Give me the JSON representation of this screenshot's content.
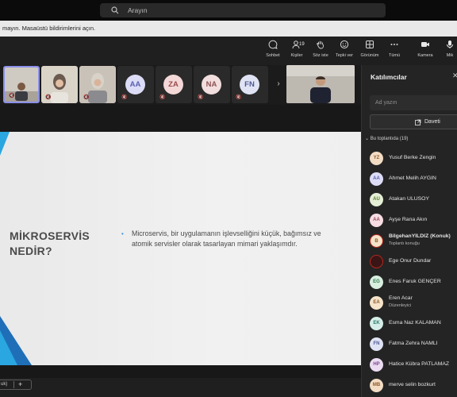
{
  "search": {
    "placeholder": "Arayın"
  },
  "notification": {
    "text": "mayın. Masaüstü bildirimlerini açın."
  },
  "toolbar": {
    "chat": "Sohbet",
    "people": "Kişiler",
    "people_count": "19",
    "raise_hand": "Söz iste",
    "react": "Tepki ver",
    "view": "Görünüm",
    "more": "Tümü",
    "camera": "Kamera",
    "mic": "Mik"
  },
  "tiles": [
    {
      "kind": "video",
      "active": true
    },
    {
      "kind": "video"
    },
    {
      "kind": "video"
    },
    {
      "kind": "avatar",
      "initials": "AA",
      "bg": "#dcdcf7",
      "fg": "#5a5fb0"
    },
    {
      "kind": "avatar",
      "initials": "ZA",
      "bg": "#f4d8d8",
      "fg": "#9a4b4b"
    },
    {
      "kind": "avatar",
      "initials": "NA",
      "bg": "#f2dede",
      "fg": "#8e5353"
    },
    {
      "kind": "avatar",
      "initials": "FN",
      "bg": "#dfe3f4",
      "fg": "#4f5a94"
    }
  ],
  "slide": {
    "title_line1": "MİKROSERVİS",
    "title_line2": "NEDİR?",
    "bullet": "Microservis, bir uygulamanın işlevselliğini küçük, bağımsız ve atomik servisler olarak tasarlayan mimari yaklaşımdır."
  },
  "bottom": {
    "pill_label": "uk)",
    "plus": "+"
  },
  "panel": {
    "title": "Katılımcılar",
    "search_placeholder": "Ad yazın",
    "invite_label": "Daveti",
    "section": "Bu toplantıda (19)",
    "participants": [
      {
        "initials": "YZ",
        "name": "Yusuf Berke Zengin",
        "role": "",
        "bg": "#f3dcc4",
        "fg": "#8a5a2b"
      },
      {
        "initials": "AA",
        "name": "Ahmet Melih AYGIN",
        "role": "",
        "bg": "#dcdcf7",
        "fg": "#5a5fb0"
      },
      {
        "initials": "AU",
        "name": "Atakan ULUSOY",
        "role": "",
        "bg": "#e4efd5",
        "fg": "#5b7a2e"
      },
      {
        "initials": "AA",
        "name": "Ayşe Rana Akın",
        "role": "",
        "bg": "#f6dde3",
        "fg": "#9b4a5c"
      },
      {
        "initials": "B",
        "name": "BilgehanYILDIZ (Konuk)",
        "role": "Toplantı konuğu",
        "bg": "#f6e3c9",
        "fg": "#8a5a2b"
      },
      {
        "initials": "",
        "name": "Ege Onur Dundar",
        "role": "",
        "bg": "#3a1515",
        "fg": "#ffffff"
      },
      {
        "initials": "EG",
        "name": "Enes Faruk GENÇER",
        "role": "",
        "bg": "#d8eedf",
        "fg": "#2f7a4f"
      },
      {
        "initials": "EA",
        "name": "Eren Acar",
        "role": "Düzenleyici",
        "bg": "#f6e3c9",
        "fg": "#8a5a2b"
      },
      {
        "initials": "EK",
        "name": "Esma Naz KALAMAN",
        "role": "",
        "bg": "#d5eee8",
        "fg": "#2d7a6a"
      },
      {
        "initials": "FN",
        "name": "Fatma Zehra NAMLI",
        "role": "",
        "bg": "#dfe3f4",
        "fg": "#4f5a94"
      },
      {
        "initials": "HP",
        "name": "Hatice Kübra PATLAMAZ",
        "role": "",
        "bg": "#ecdcf2",
        "fg": "#7a4a8a"
      },
      {
        "initials": "MB",
        "name": "merve selin bozkurt",
        "role": "",
        "bg": "#f3dcc4",
        "fg": "#8a5a2b"
      }
    ]
  }
}
